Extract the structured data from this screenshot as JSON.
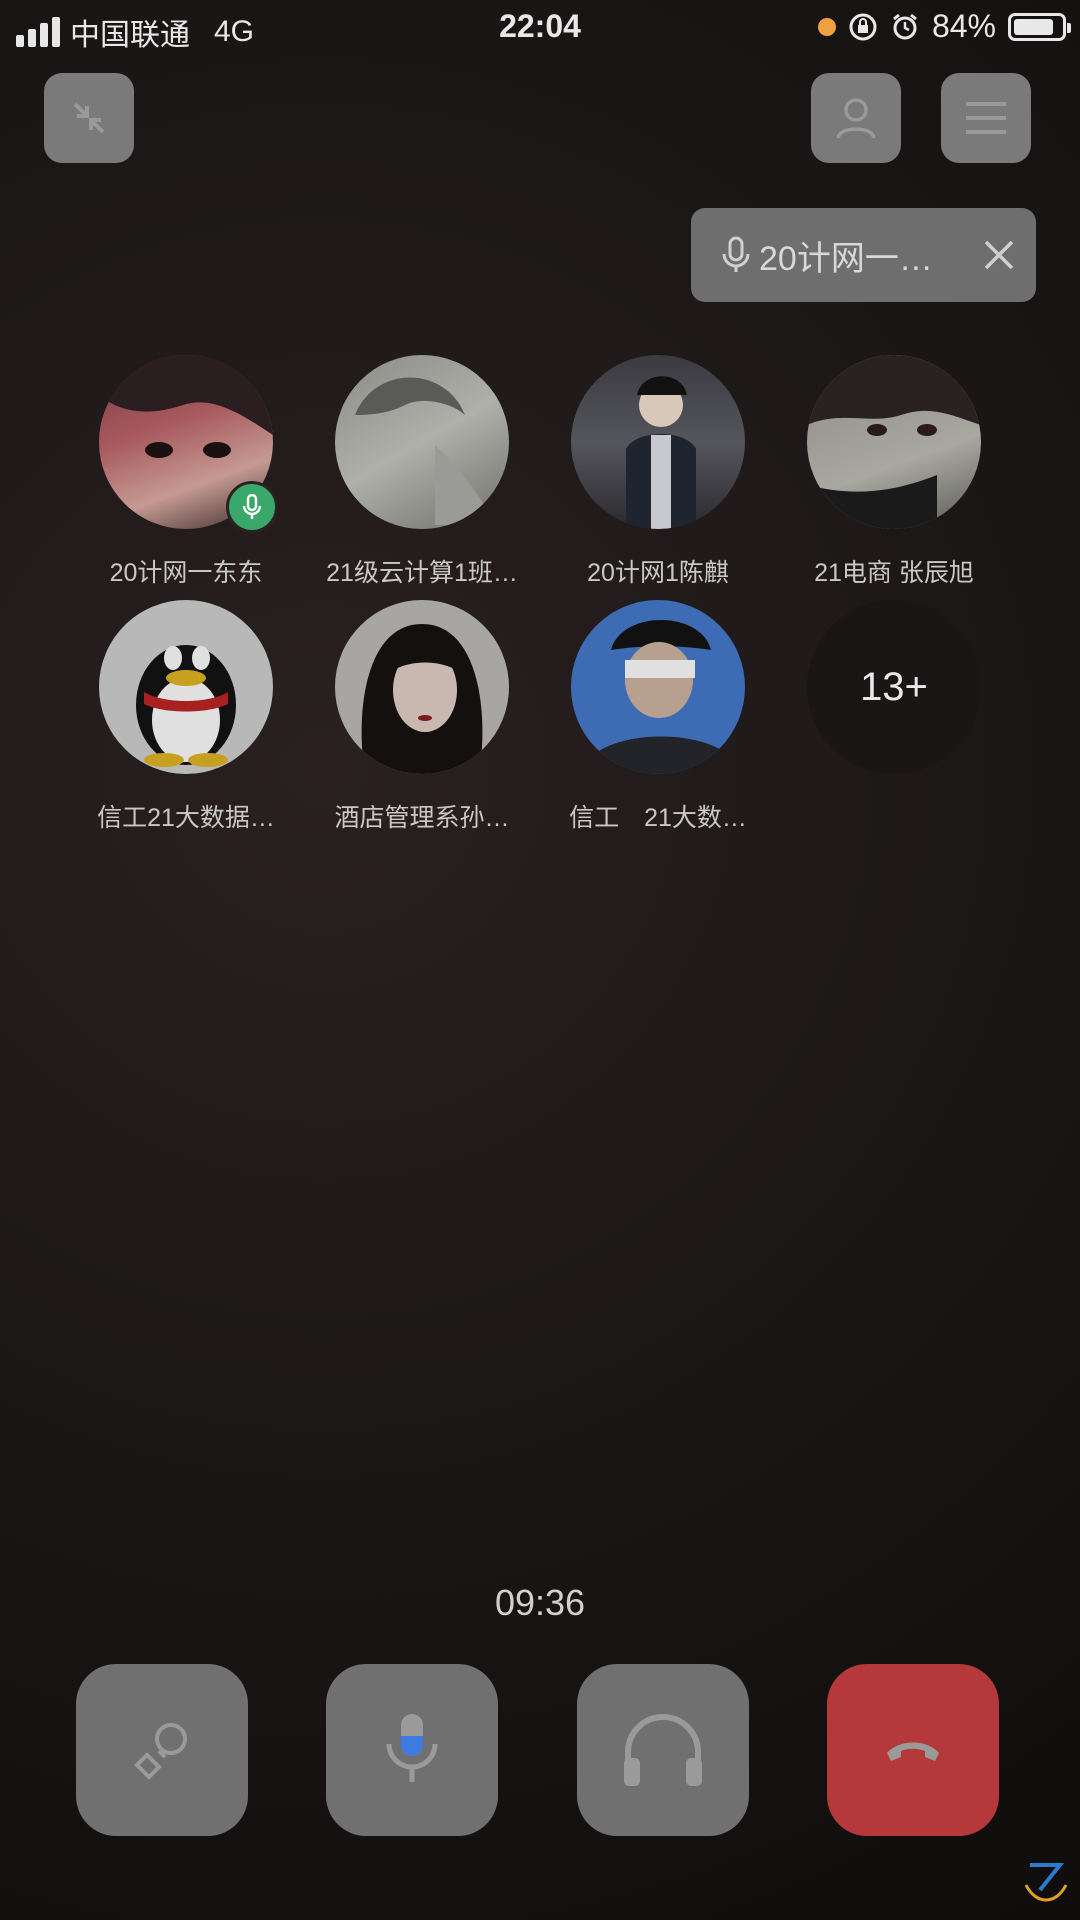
{
  "status_bar": {
    "carrier": "中国联通",
    "network": "4G",
    "time": "22:04",
    "battery": "84%",
    "battery_level": 0.84
  },
  "speaking": {
    "label": "20计网一…"
  },
  "participants": [
    {
      "name": "20计网一东东",
      "speaking": true
    },
    {
      "name": "21级云计算1班…",
      "speaking": false
    },
    {
      "name": "20计网1陈麒",
      "speaking": false
    },
    {
      "name": "21电商 张辰旭",
      "speaking": false
    },
    {
      "name": "信工21大数据…",
      "speaking": false
    },
    {
      "name": "酒店管理系孙…",
      "speaking": false
    },
    {
      "name": "信工　21大数…",
      "speaking": false
    }
  ],
  "more_count": "13+",
  "call_timer": "09:36",
  "colors": {
    "hangup": "#b5393b",
    "speaking_badge": "#3aa86a",
    "mic_active": "#3d7be0"
  },
  "icons": {
    "top": [
      "shrink-icon",
      "member-icon",
      "menu-icon"
    ],
    "bottom": [
      "screen-share-icon",
      "microphone-icon",
      "headphones-icon",
      "hangup-icon"
    ]
  }
}
